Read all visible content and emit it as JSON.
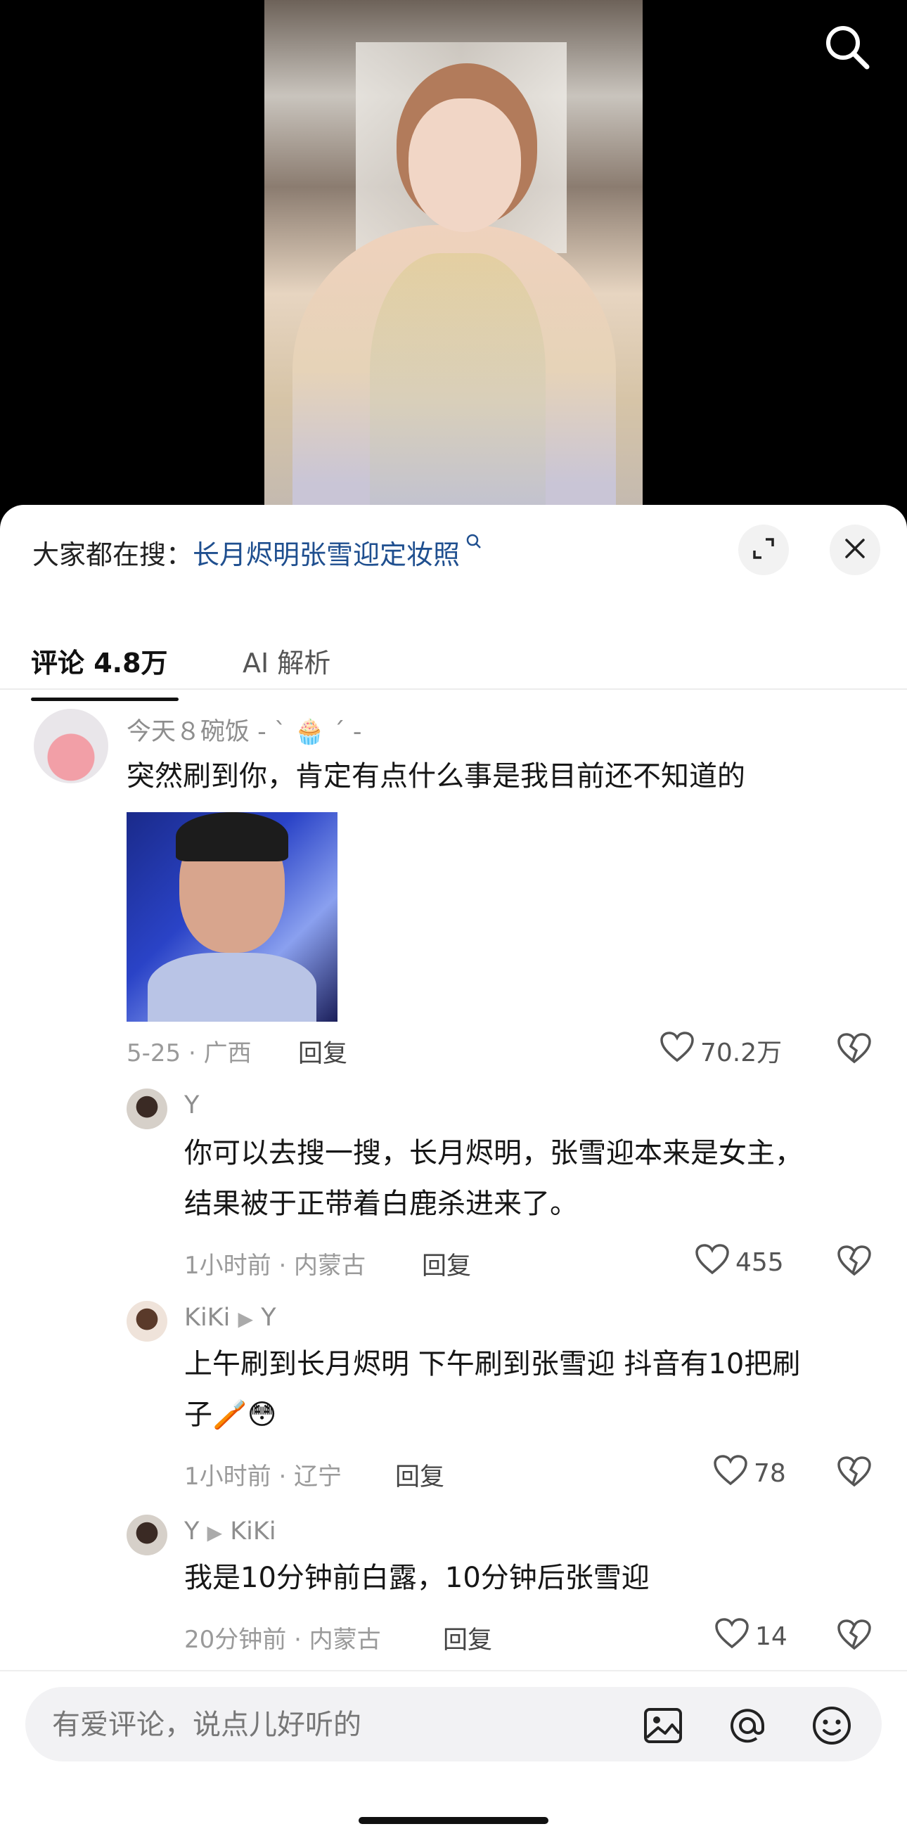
{
  "search": {
    "heading": "大家都在搜：",
    "query": "长月烬明张雪迎定妆照"
  },
  "tabs": [
    {
      "label": "评论 4.8万"
    },
    {
      "label": "AI 解析"
    }
  ],
  "comments": {
    "main": {
      "username": "今天８碗饭 - ` 🧁 ´ -",
      "text": "突然刷到你，肯定有点什么事是我目前还不知道的",
      "meta": "5-25 · 广西",
      "reply_label": "回复",
      "likes": "70.2万"
    },
    "replies": [
      {
        "username": "Y",
        "target": "",
        "lines": [
          "你可以去搜一搜，长月烬明，张雪迎本来是女主，",
          "结果被于正带着白鹿杀进来了。"
        ],
        "meta": "1小时前 · 内蒙古",
        "reply_label": "回复",
        "likes": "455"
      },
      {
        "username": "KiKi",
        "target": "Y",
        "lines": [
          "上午刷到长月烬明 下午刷到张雪迎 抖音有10把刷",
          "子🪥😳"
        ],
        "meta": "1小时前 · 辽宁",
        "reply_label": "回复",
        "likes": "78"
      },
      {
        "username": "Y",
        "target": "KiKi",
        "lines": [
          "我是10分钟前白露，10分钟后张雪迎"
        ],
        "meta": "20分钟前 · 内蒙古",
        "reply_label": "回复",
        "likes": "14"
      }
    ]
  },
  "input": {
    "placeholder": "有爱评论，说点儿好听的"
  },
  "icons": [
    "search-icon",
    "expand-icon",
    "close-icon",
    "heart-icon",
    "broken-heart-icon",
    "image-icon",
    "at-icon",
    "emoji-icon"
  ]
}
